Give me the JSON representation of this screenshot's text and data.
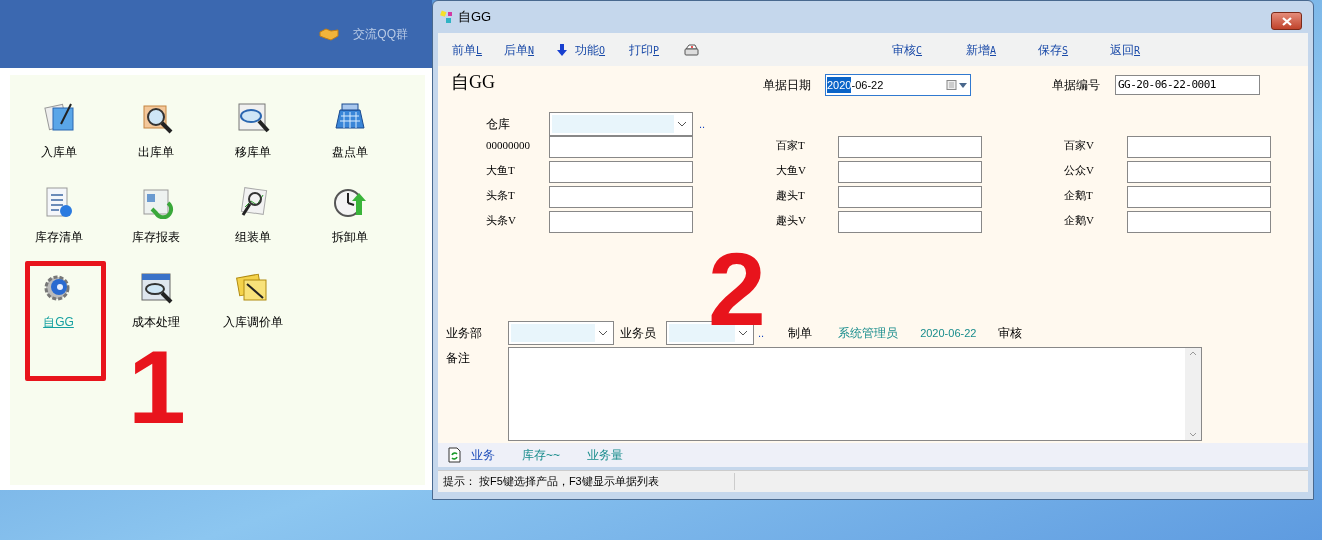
{
  "main_window": {
    "header_link": {
      "label": "交流QQ群"
    },
    "modules": [
      {
        "label": "入库单",
        "selected": false
      },
      {
        "label": "出库单",
        "selected": false
      },
      {
        "label": "移库单",
        "selected": false
      },
      {
        "label": "盘点单",
        "selected": false
      },
      {
        "label": "库存清单",
        "selected": false
      },
      {
        "label": "库存报表",
        "selected": false
      },
      {
        "label": "组装单",
        "selected": false
      },
      {
        "label": "拆卸单",
        "selected": false
      },
      {
        "label": "自GG",
        "selected": true
      },
      {
        "label": "成本处理",
        "selected": false
      },
      {
        "label": "入库调价单",
        "selected": false
      }
    ]
  },
  "dialog": {
    "title": "自GG",
    "toolbar": [
      {
        "kind": "text",
        "label": "前单",
        "key": "L"
      },
      {
        "kind": "text",
        "label": "后单",
        "key": "N"
      },
      {
        "kind": "down",
        "label": "功能",
        "key": "O"
      },
      {
        "kind": "text",
        "label": "打印",
        "key": "P"
      },
      {
        "kind": "printer"
      },
      {
        "kind": "text",
        "label": "审核",
        "key": "C"
      },
      {
        "kind": "text",
        "label": "新增",
        "key": "A"
      },
      {
        "kind": "text",
        "label": "保存",
        "key": "S"
      },
      {
        "kind": "text",
        "label": "返回",
        "key": "R"
      }
    ],
    "heading": "自GG",
    "date": {
      "label": "单据日期",
      "selected_part": "2020",
      "value": "-06-22"
    },
    "number": {
      "label": "单据编号",
      "value": "GG-20-06-22-0001"
    },
    "warehouse": {
      "label": "仓库",
      "more": ".."
    },
    "fields": [
      {
        "label": "00000000"
      },
      {
        "label": "百家T"
      },
      {
        "label": "百家V"
      },
      {
        "label": "大鱼T"
      },
      {
        "label": "大鱼V"
      },
      {
        "label": "公众V"
      },
      {
        "label": "头条T"
      },
      {
        "label": "趣头T"
      },
      {
        "label": "企鹅T"
      },
      {
        "label": "头条V"
      },
      {
        "label": "趣头V"
      },
      {
        "label": "企鹅V"
      }
    ],
    "department": {
      "label": "业务部"
    },
    "salesman": {
      "label": "业务员",
      "more": ".."
    },
    "maker": {
      "label": "制单",
      "value": "系统管理员",
      "date": "2020-06-22"
    },
    "review": {
      "label": "审核"
    },
    "remark": {
      "label": "备注"
    },
    "tabs": [
      {
        "label": "业务",
        "selected": true
      },
      {
        "label": "库存~~",
        "selected": false
      },
      {
        "label": "业务量",
        "selected": false
      }
    ],
    "status_bar": "提示：  按F5键选择产品，F3键显示单据列表"
  },
  "annotations": [
    {
      "kind": "box"
    },
    {
      "kind": "number",
      "label": "1"
    },
    {
      "kind": "number",
      "label": "2"
    }
  ]
}
